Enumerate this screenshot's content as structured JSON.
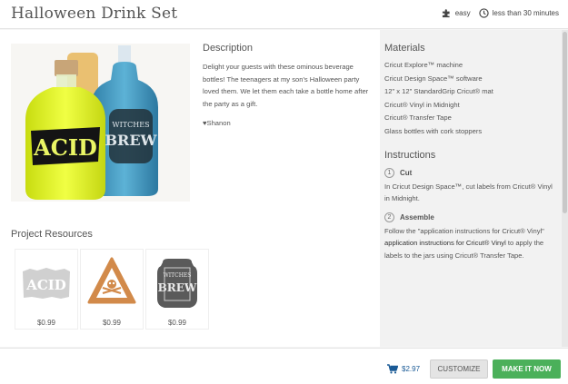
{
  "header": {
    "title": "Halloween Drink Set",
    "difficulty_icon": "puzzle-icon",
    "difficulty": "easy",
    "time_icon": "clock-icon",
    "time": "less than 30 minutes"
  },
  "photo": {
    "labels": [
      "ACID",
      "WITCHES",
      "BREW"
    ],
    "colors": {
      "acid": "#d4e81a",
      "brew": "#3c8fb8",
      "amber": "#e0a336"
    }
  },
  "description": {
    "heading": "Description",
    "text": "Delight your guests with these ominous beverage bottles! The teenagers at my son's Halloween party loved them. We let them each take a bottle home after the party as a gift.",
    "author": "Shanon",
    "author_icon": "heart-icon"
  },
  "resources": {
    "heading": "Project Resources",
    "items": [
      {
        "icon": "acid-label-icon",
        "art_text": "ACID",
        "price": "$0.99"
      },
      {
        "icon": "poison-triangle-icon",
        "art_text": "",
        "price": "$0.99"
      },
      {
        "icon": "witches-brew-label-icon",
        "art_text": "WITCHES BREW",
        "price": "$0.99"
      }
    ]
  },
  "materials": {
    "heading": "Materials",
    "items": [
      "Cricut Explore™ machine",
      "Cricut Design Space™ software",
      "12\" x 12\" StandardGrip Cricut® mat",
      "Cricut® Vinyl in Midnight",
      "Cricut® Transfer Tape",
      "Glass bottles with cork stoppers"
    ]
  },
  "instructions": {
    "heading": "Instructions",
    "steps": [
      {
        "num": "1",
        "title": "Cut",
        "text": "In Cricut Design Space™, cut labels from Cricut® Vinyl in Midnight."
      },
      {
        "num": "2",
        "title": "Assemble",
        "text_a": "Follow the \"application instructions for Cricut® Vinyl\" ",
        "text_b": "application instructions for Cricut® Vinyl",
        "text_c": " to apply the labels to the jars using Cricut® Transfer Tape."
      }
    ]
  },
  "footer": {
    "cart_icon": "cart-icon",
    "price": "$2.97",
    "customize_label": "CUSTOMIZE",
    "make_label": "MAKE IT NOW"
  },
  "colors": {
    "accent_green": "#4bb05a",
    "link_blue": "#1a5a96"
  }
}
